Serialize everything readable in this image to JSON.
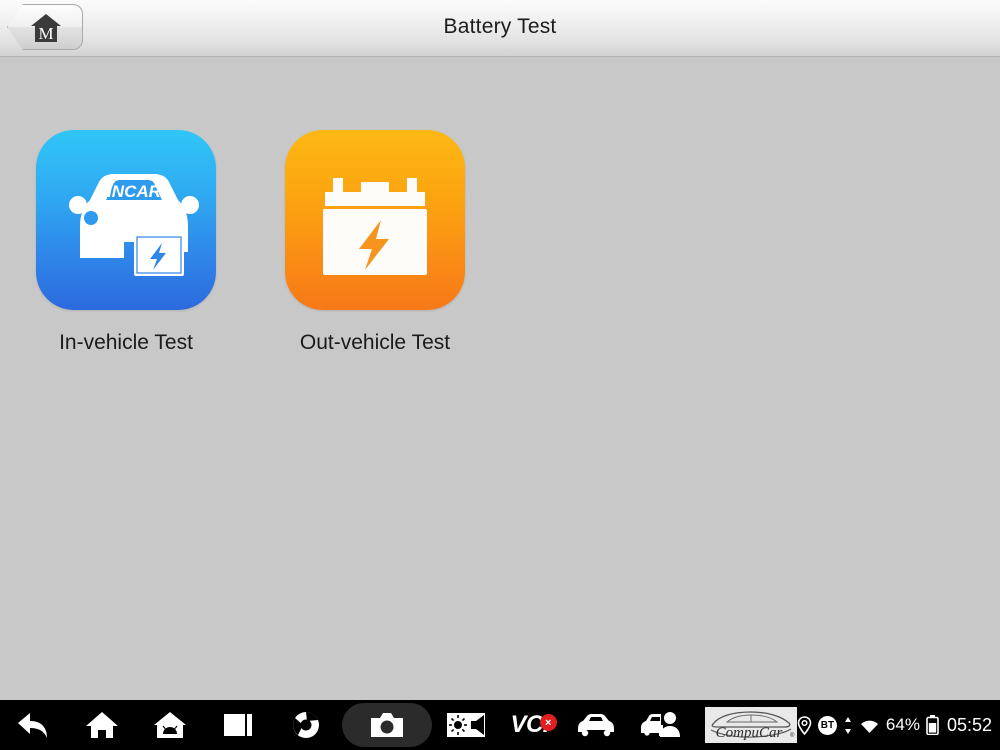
{
  "header": {
    "title": "Battery Test",
    "home_button": {
      "icon": "home-m-icon",
      "letter": "M"
    }
  },
  "main": {
    "tiles": [
      {
        "label": "In-vehicle Test",
        "icon": "car-with-battery-icon",
        "badge_text": "INCAR",
        "color_start": "#31c6f7",
        "color_end": "#2c6ade"
      },
      {
        "label": "Out-vehicle Test",
        "icon": "battery-icon",
        "color_start": "#fdb813",
        "color_end": "#f77818"
      }
    ]
  },
  "taskbar": {
    "items": [
      {
        "name": "back-icon",
        "label": "Back"
      },
      {
        "name": "home-icon",
        "label": "Home"
      },
      {
        "name": "android-home-icon",
        "label": "Android Home"
      },
      {
        "name": "recent-apps-icon",
        "label": "Recent Apps"
      },
      {
        "name": "browser-icon",
        "label": "Browser"
      },
      {
        "name": "camera-icon",
        "label": "Camera"
      },
      {
        "name": "display-audio-icon",
        "label": "Display & Audio"
      },
      {
        "name": "vci-icon",
        "label": "VCI"
      },
      {
        "name": "vehicle-icon",
        "label": "Vehicle"
      },
      {
        "name": "service-icon",
        "label": "Service"
      }
    ],
    "vci": {
      "text": "VCI",
      "badge": "×"
    },
    "logo": {
      "text": "CompuCar",
      "mark": "®"
    },
    "status": {
      "location_icon": "location-pin-icon",
      "bluetooth_label": "BT",
      "data_icon": "data-transfer-icon",
      "wifi_icon": "wifi-icon",
      "battery_percent": "64%",
      "battery_icon": "battery-status-icon",
      "time": "05:52"
    }
  }
}
